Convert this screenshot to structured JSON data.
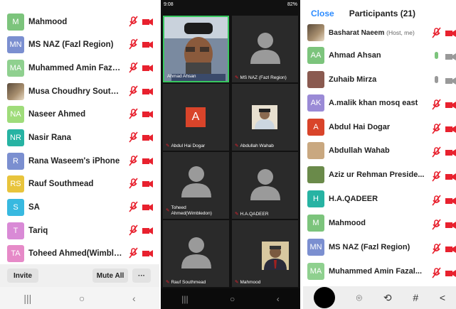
{
  "left": {
    "participants": [
      {
        "initials": "M",
        "name": "Mahmood",
        "color": "#7cc47c"
      },
      {
        "initials": "MN",
        "name": "MS NAZ (Fazl Region)",
        "color": "#7b8fd0"
      },
      {
        "initials": "MA",
        "name": "Muhammed Amin Fazal...",
        "color": "#8fd08f"
      },
      {
        "initials": "",
        "name": "Musa Choudhry Southfie...",
        "color": "#8a7a60"
      },
      {
        "initials": "NA",
        "name": "Naseer Ahmed",
        "color": "#9fdc7a"
      },
      {
        "initials": "NR",
        "name": "Nasir Rana",
        "color": "#27b3a3"
      },
      {
        "initials": "R",
        "name": "Rana Waseem's iPhone",
        "color": "#7b8fd0"
      },
      {
        "initials": "RS",
        "name": "Rauf Southmead",
        "color": "#e8c43c"
      },
      {
        "initials": "S",
        "name": "SA",
        "color": "#38b9e0"
      },
      {
        "initials": "T",
        "name": "Tariq",
        "color": "#d98ad6"
      },
      {
        "initials": "TA",
        "name": "Toheed Ahmed(Wimbled...",
        "color": "#e68ac8"
      }
    ],
    "invite_label": "Invite",
    "mute_all_label": "Mute All",
    "more_label": "···"
  },
  "mid": {
    "status_time": "9:08",
    "status_battery": "82%",
    "tiles": [
      {
        "label": "Ahmad Ahsan",
        "kind": "photo"
      },
      {
        "label": "MS NAZ (Fazl Region)",
        "kind": "silhouette"
      },
      {
        "label": "Abdul Hai Dogar",
        "kind": "letter",
        "letter": "A"
      },
      {
        "label": "Abdullah Wahab",
        "kind": "photo"
      },
      {
        "label": "Toheed Ahmed(Wimbledon)",
        "kind": "silhouette"
      },
      {
        "label": "H.A.QADEER",
        "kind": "silhouette"
      },
      {
        "label": "Rauf Southmead",
        "kind": "silhouette"
      },
      {
        "label": "Mahmood",
        "kind": "photo"
      }
    ]
  },
  "right": {
    "close_label": "Close",
    "title": "Participants (21)",
    "participants": [
      {
        "initials": "",
        "name": "Basharat Naeem",
        "suffix": "(Host, me)",
        "color": "#6b5a45"
      },
      {
        "initials": "AA",
        "name": "Ahmad Ahsan",
        "suffix": "",
        "color": "#7cc47c"
      },
      {
        "initials": "",
        "name": "Zuhaib Mirza",
        "suffix": "",
        "color": "#8a5a50"
      },
      {
        "initials": "AK",
        "name": "A.malik khan  mosq east",
        "suffix": "",
        "color": "#9a8ad6"
      },
      {
        "initials": "A",
        "name": "Abdul Hai Dogar",
        "suffix": "",
        "color": "#d9442a"
      },
      {
        "initials": "",
        "name": "Abdullah Wahab",
        "suffix": "",
        "color": "#c9a880"
      },
      {
        "initials": "",
        "name": "Aziz ur Rehman  Preside...",
        "suffix": "",
        "color": "#6a8a4a"
      },
      {
        "initials": "H",
        "name": "H.A.QADEER",
        "suffix": "",
        "color": "#27b3a3"
      },
      {
        "initials": "M",
        "name": "Mahmood",
        "suffix": "",
        "color": "#7cc47c"
      },
      {
        "initials": "MN",
        "name": "MS NAZ (Fazl Region)",
        "suffix": "",
        "color": "#7b8fd0"
      },
      {
        "initials": "MA",
        "name": "Muhammed Amin Fazal...",
        "suffix": "",
        "color": "#8fd08f"
      }
    ]
  },
  "colors": {
    "accent": "#2d8cff",
    "muted": "#e8212e"
  }
}
